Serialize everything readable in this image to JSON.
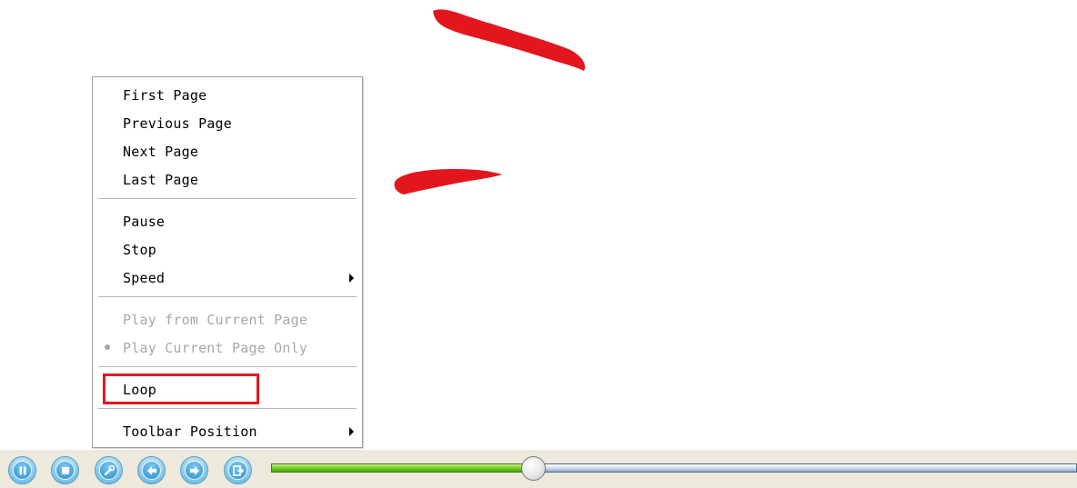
{
  "colors": {
    "annotation_red": "#e3161e",
    "menu_text": "#000000",
    "menu_disabled": "#a8a8a8",
    "toolbar_bg": "#ede9dc",
    "seek_played": "#6ec61f",
    "button_blue": "#4aa9dc"
  },
  "menu": {
    "items": [
      {
        "label": "First Page"
      },
      {
        "label": "Previous Page"
      },
      {
        "label": "Next Page"
      },
      {
        "label": "Last Page"
      },
      {
        "label": "Pause"
      },
      {
        "label": "Stop"
      },
      {
        "label": "Speed",
        "submenu": true
      },
      {
        "label": "Play from Current Page",
        "disabled": true
      },
      {
        "label": "Play Current Page Only",
        "disabled": true,
        "selected": true
      },
      {
        "label": "Loop",
        "highlighted": true
      },
      {
        "label": "Toolbar Position",
        "submenu": true
      }
    ]
  },
  "toolbar": {
    "buttons": [
      {
        "icon": "pause-icon"
      },
      {
        "icon": "stop-icon"
      },
      {
        "icon": "settings-wrench-icon"
      },
      {
        "icon": "previous-arrow-icon"
      },
      {
        "icon": "next-arrow-icon"
      },
      {
        "icon": "exit-icon"
      }
    ],
    "progress_fraction": 0.32
  }
}
